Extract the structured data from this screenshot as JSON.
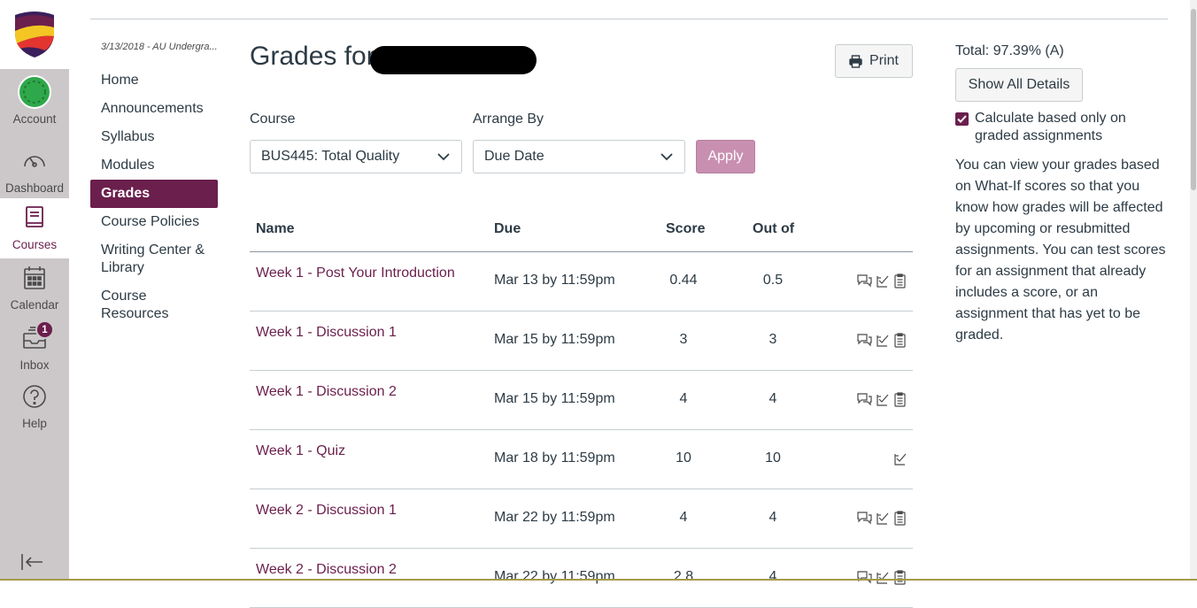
{
  "global_nav": {
    "items": [
      {
        "label": "Account",
        "icon": "account-avatar-icon"
      },
      {
        "label": "Dashboard",
        "icon": "dashboard-icon"
      },
      {
        "label": "Courses",
        "icon": "courses-icon"
      },
      {
        "label": "Calendar",
        "icon": "calendar-icon"
      },
      {
        "label": "Inbox",
        "icon": "inbox-icon",
        "badge": "1"
      },
      {
        "label": "Help",
        "icon": "help-icon"
      }
    ],
    "active": "Courses"
  },
  "breadcrumb": "3/13/2018 - AU Undergra...",
  "course_nav": {
    "items": [
      "Home",
      "Announcements",
      "Syllabus",
      "Modules",
      "Grades",
      "Course Policies",
      "Writing Center & Library",
      "Course Resources"
    ],
    "active": "Grades"
  },
  "page": {
    "title": "Grades for",
    "print_label": "Print"
  },
  "filters": {
    "course_label": "Course",
    "course_value": "BUS445: Total Quality",
    "arrange_label": "Arrange By",
    "arrange_value": "Due Date",
    "apply_label": "Apply"
  },
  "table": {
    "headers": {
      "name": "Name",
      "due": "Due",
      "score": "Score",
      "out_of": "Out of"
    },
    "rows": [
      {
        "name": "Week 1 - Post Your Introduction",
        "due": "Mar 13 by 11:59pm",
        "score": "0.44",
        "out_of": "0.5",
        "icons": [
          "comments-icon",
          "rubric-icon",
          "details-icon"
        ]
      },
      {
        "name": "Week 1 - Discussion 1",
        "due": "Mar 15 by 11:59pm",
        "score": "3",
        "out_of": "3",
        "icons": [
          "comments-icon",
          "rubric-icon",
          "details-icon"
        ]
      },
      {
        "name": "Week 1 - Discussion 2",
        "due": "Mar 15 by 11:59pm",
        "score": "4",
        "out_of": "4",
        "icons": [
          "comments-icon",
          "rubric-icon",
          "details-icon"
        ]
      },
      {
        "name": "Week 1 - Quiz",
        "due": "Mar 18 by 11:59pm",
        "score": "10",
        "out_of": "10",
        "icons": [
          "rubric-icon"
        ]
      },
      {
        "name": "Week 2 - Discussion 1",
        "due": "Mar 22 by 11:59pm",
        "score": "4",
        "out_of": "4",
        "icons": [
          "comments-icon",
          "rubric-icon",
          "details-icon"
        ]
      },
      {
        "name": "Week 2 - Discussion 2",
        "due": "Mar 22 by 11:59pm",
        "score": "2.8",
        "out_of": "4",
        "icons": [
          "comments-icon",
          "rubric-icon",
          "details-icon"
        ]
      }
    ]
  },
  "sidebar": {
    "total": "Total: 97.39% (A)",
    "show_all_label": "Show All Details",
    "calc_label": "Calculate based only on graded assignments",
    "calc_checked": true,
    "whatif_text": "You can view your grades based on What-If scores so that you know how grades will be affected by upcoming or resubmitted assignments. You can test scores for an assignment that already includes a score, or an assignment that has yet to be graded."
  },
  "colors": {
    "brand": "#6b1f4c",
    "nav_bg": "#ccc8c9",
    "apply_disabled": "#c88fb0"
  }
}
